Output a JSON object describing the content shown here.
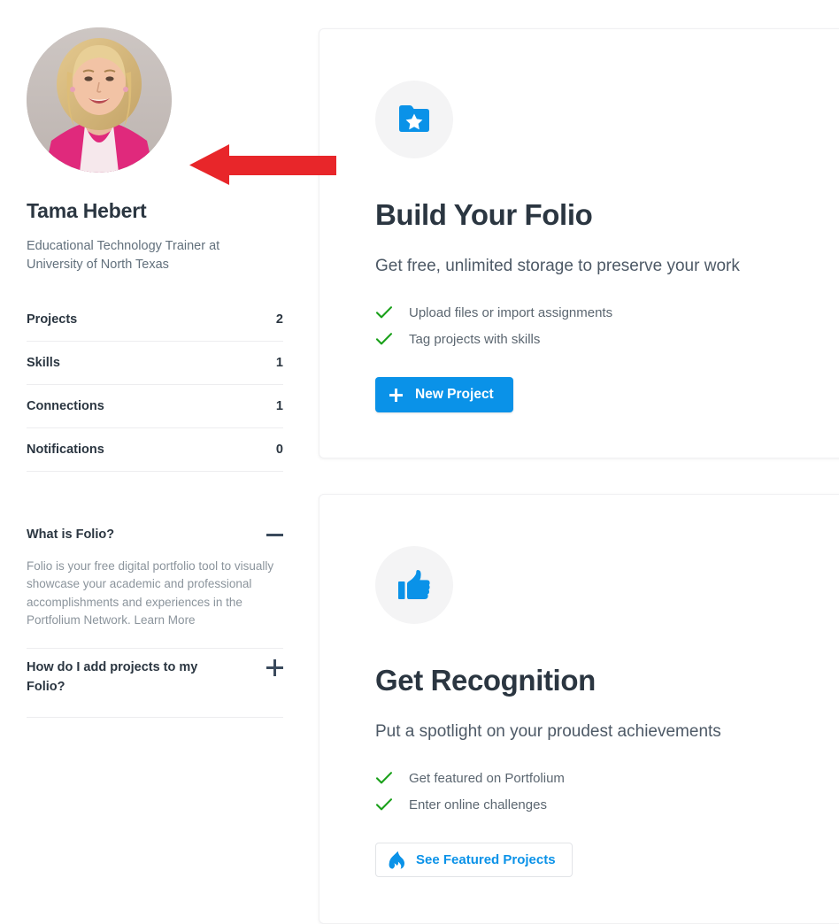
{
  "colors": {
    "brand_blue": "#0a92e8",
    "check_green": "#19a019",
    "text_dark": "#2b3641",
    "text_muted": "#62707c",
    "annotation_red": "#e8262a",
    "icon_circle_bg": "#f4f4f5"
  },
  "sidebar": {
    "avatar": {
      "icon": "user-photo-avatar",
      "alt": "Tama Hebert profile photo"
    },
    "profile": {
      "name": "Tama Hebert",
      "headline": "Educational Technology Trainer at University of North Texas"
    },
    "stats": [
      {
        "label": "Projects",
        "value": "2"
      },
      {
        "label": "Skills",
        "value": "1"
      },
      {
        "label": "Connections",
        "value": "1"
      },
      {
        "label": "Notifications",
        "value": "0"
      }
    ],
    "faq": [
      {
        "question": "What is Folio?",
        "toggle_icon": "minus-icon",
        "expanded": true,
        "answer": "Folio is your free digital portfolio tool to visually showcase your academic and professional accomplishments and experiences in the Portfolium Network. Learn More"
      },
      {
        "question": "How do I add projects to my Folio?",
        "toggle_icon": "plus-icon",
        "expanded": false,
        "answer": ""
      }
    ]
  },
  "main": {
    "cards": [
      {
        "id": "build-your-folio",
        "icon": "folder-star-icon",
        "title": "Build Your Folio",
        "subtitle": "Get free, unlimited storage to preserve your work",
        "bullets": [
          "Upload files or import assignments",
          "Tag projects with skills"
        ],
        "button": {
          "label": "New Project",
          "icon": "plus-icon",
          "style": "primary"
        }
      },
      {
        "id": "get-recognition",
        "icon": "thumbs-up-icon",
        "title": "Get Recognition",
        "subtitle": "Put a spotlight on your proudest achievements",
        "bullets": [
          "Get featured on Portfolium",
          "Enter online challenges"
        ],
        "button": {
          "label": "See Featured Projects",
          "icon": "flame-icon",
          "style": "secondary"
        }
      }
    ]
  },
  "annotation": {
    "type": "arrow",
    "direction": "left",
    "color": "#e8262a",
    "points_to": "profile-avatar"
  }
}
